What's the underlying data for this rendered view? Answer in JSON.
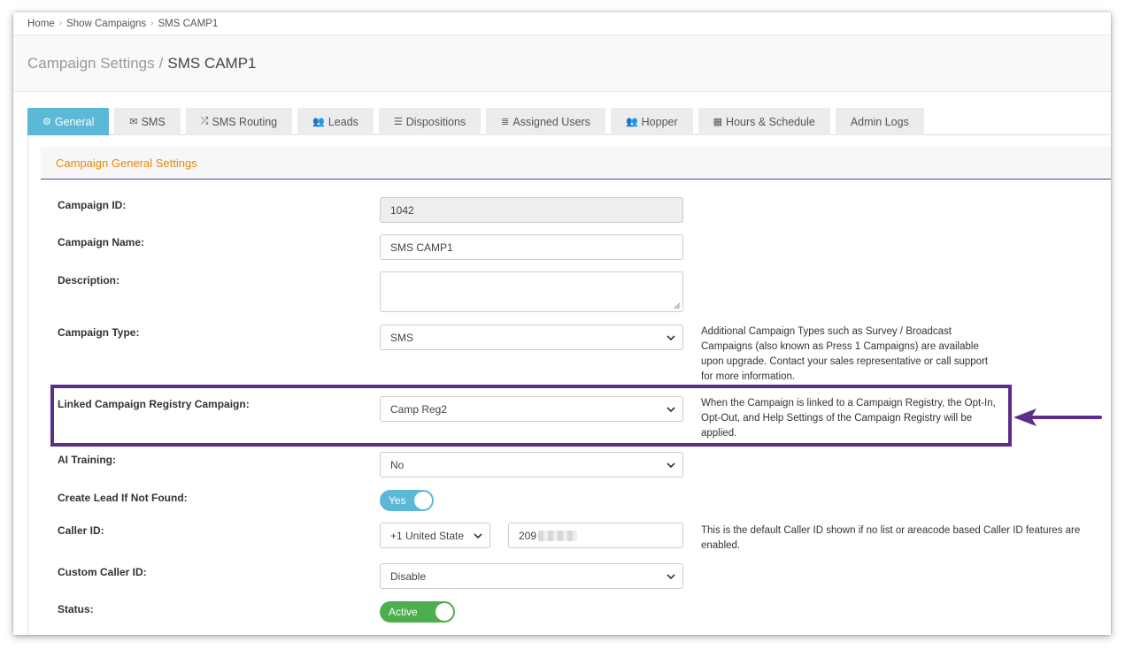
{
  "breadcrumb": {
    "items": [
      "Home",
      "Show Campaigns",
      "SMS CAMP1"
    ]
  },
  "header": {
    "section": "Campaign Settings",
    "separator": "/",
    "name": "SMS CAMP1"
  },
  "tabs": [
    {
      "label": "General",
      "icon": "gears-icon",
      "active": true
    },
    {
      "label": "SMS",
      "icon": "envelope-icon"
    },
    {
      "label": "SMS Routing",
      "icon": "shuffle-icon"
    },
    {
      "label": "Leads",
      "icon": "users-icon"
    },
    {
      "label": "Dispositions",
      "icon": "list-icon"
    },
    {
      "label": "Assigned Users",
      "icon": "ordered-list-icon"
    },
    {
      "label": "Hopper",
      "icon": "users-icon"
    },
    {
      "label": "Hours & Schedule",
      "icon": "calendar-icon"
    },
    {
      "label": "Admin Logs",
      "icon": ""
    }
  ],
  "panel": {
    "title": "Campaign General Settings"
  },
  "form": {
    "campaign_id": {
      "label": "Campaign ID:",
      "value": "1042"
    },
    "campaign_name": {
      "label": "Campaign Name:",
      "value": "SMS CAMP1"
    },
    "description": {
      "label": "Description:",
      "value": ""
    },
    "campaign_type": {
      "label": "Campaign Type:",
      "value": "SMS",
      "help": "Additional Campaign Types such as Survey / Broadcast Campaigns (also known as Press 1 Campaigns) are available upon upgrade. Contact your sales representative or call support for more information."
    },
    "linked_registry": {
      "label": "Linked Campaign Registry Campaign:",
      "value": "Camp Reg2",
      "help": "When the Campaign is linked to a Campaign Registry, the Opt-In, Opt-Out, and Help Settings of the Campaign Registry will be applied."
    },
    "ai_training": {
      "label": "AI Training:",
      "value": "No"
    },
    "create_lead": {
      "label": "Create Lead If Not Found:",
      "toggle": "Yes"
    },
    "caller_id": {
      "label": "Caller ID:",
      "country": "+1 United State",
      "number": "209",
      "help": "This is the default Caller ID shown if no list or areacode based Caller ID features are enabled."
    },
    "custom_caller_id": {
      "label": "Custom Caller ID:",
      "value": "Disable"
    },
    "status": {
      "label": "Status:",
      "toggle": "Active"
    }
  },
  "colors": {
    "tab_active": "#5bb8d6",
    "panel_title": "#e68a00",
    "highlight": "#5c2d8a",
    "toggle_yes": "#5bb8d6",
    "toggle_active": "#4cae4c"
  }
}
